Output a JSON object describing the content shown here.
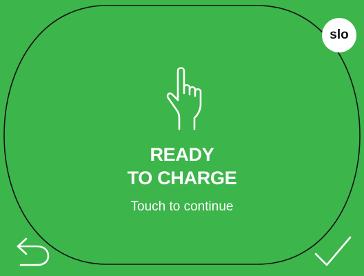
{
  "screen": {
    "background_color": "#3cb54a",
    "accent_color": "#ffffff"
  },
  "language": {
    "code": "slo"
  },
  "main": {
    "icon": "touch-hand-icon",
    "title_line1": "READY",
    "title_line2": "TO CHARGE",
    "subtitle": "Touch to continue"
  },
  "footer": {
    "back_icon": "back-arrow-icon",
    "confirm_icon": "checkmark-icon"
  }
}
